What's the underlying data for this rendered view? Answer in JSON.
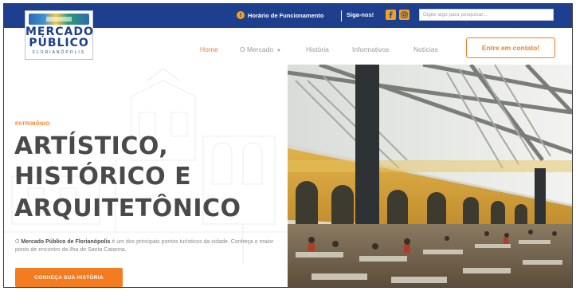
{
  "topbar": {
    "hours_label": "Horário de Funcionamento",
    "follow_label": "Siga-nos!",
    "social": [
      "facebook-icon",
      "instagram-icon"
    ],
    "search_placeholder": "Digite algo para pesquisar..."
  },
  "logo": {
    "line1": "MERCADO",
    "line2": "PÚBLICO",
    "line3": "FLORIANÓPOLIS"
  },
  "nav": {
    "home": "Home",
    "mercado": "O Mercado",
    "historia": "História",
    "info": "Informativos",
    "news": "Notícias",
    "contact": "Entre em contato!"
  },
  "hero": {
    "eyebrow": "PATRIMÔNIO",
    "title_line1": "ARTÍSTICO,",
    "title_line2": "HISTÓRICO E",
    "title_line3": "ARQUITETÔNICO",
    "desc_prefix": "O ",
    "desc_strong": "Mercado Público de Florianópolis",
    "desc_rest": " é um dos principais pontos turísticos da cidade. Conheça o maior ponto de encontro da Ilha de Santa Catarina.",
    "cta": "CONHEÇA SUA HISTÓRIA"
  },
  "colors": {
    "brand_blue": "#1d3f8e",
    "accent_orange": "#f47c20",
    "social_yellow": "#f4a21b"
  }
}
